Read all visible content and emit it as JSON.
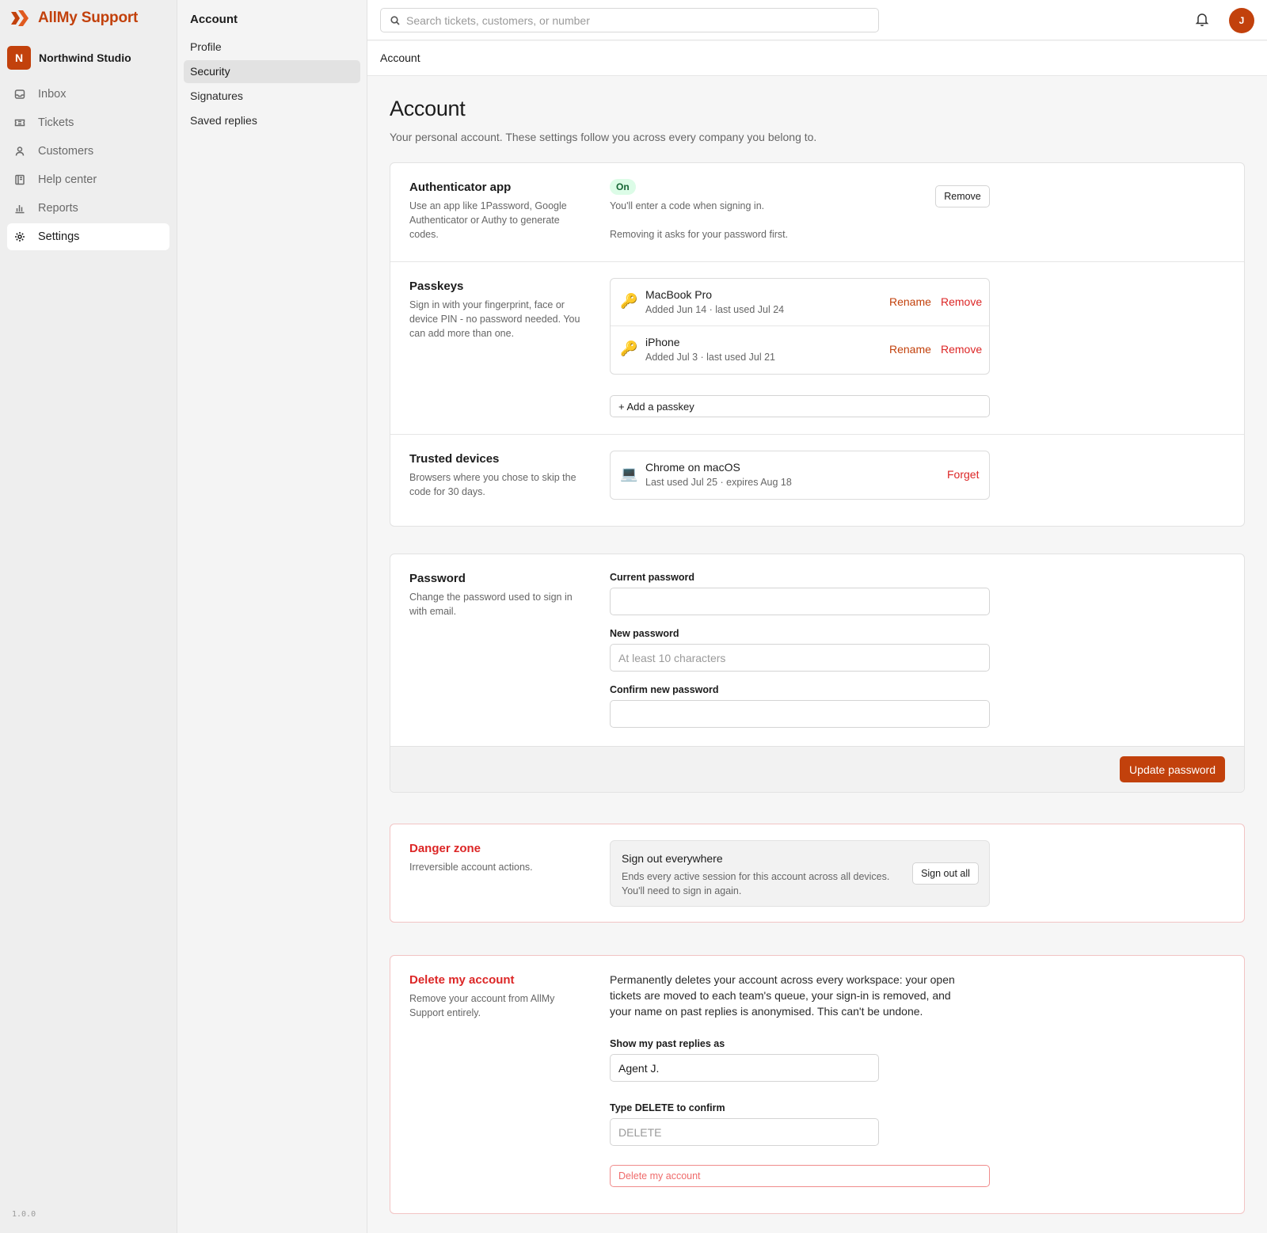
{
  "brand": {
    "name": "AllMy Support",
    "accent": "#c2410c"
  },
  "workspace": {
    "initial": "N",
    "name": "Northwind Studio"
  },
  "nav": {
    "items": [
      {
        "label": "Inbox",
        "icon": "inbox-icon"
      },
      {
        "label": "Tickets",
        "icon": "ticket-icon"
      },
      {
        "label": "Customers",
        "icon": "person-icon"
      },
      {
        "label": "Help center",
        "icon": "book-icon"
      },
      {
        "label": "Reports",
        "icon": "bar-chart-icon"
      },
      {
        "label": "Settings",
        "icon": "gear-icon",
        "active": true
      }
    ]
  },
  "version": "1.0.0",
  "subnav": {
    "title": "Account",
    "items": [
      "Profile",
      "Security",
      "Signatures",
      "Saved replies"
    ],
    "active": "Security"
  },
  "topbar": {
    "search_placeholder": "Search tickets, customers, or number",
    "user_initial": "J"
  },
  "breadcrumb": "Account",
  "page": {
    "title": "Account",
    "subtitle": "Your personal account. These settings follow you across every company you belong to."
  },
  "security": {
    "authenticator": {
      "title": "Authenticator app",
      "desc": "Use an app like 1Password, Google Authenticator or Authy to generate codes.",
      "status": "On",
      "status_color": "#166534",
      "info": "You'll enter a code when signing in.",
      "note": "Removing it asks for your password first.",
      "remove_label": "Remove"
    },
    "passkeys": {
      "title": "Passkeys",
      "desc": "Sign in with your fingerprint, face or device PIN - no password needed. You can add more than one.",
      "items": [
        {
          "name": "MacBook Pro",
          "meta": "Added Jun 14 · last used Jul 24",
          "icon": "key-icon"
        },
        {
          "name": "iPhone",
          "meta": "Added Jul 3 · last used Jul 21",
          "icon": "key-icon"
        }
      ],
      "rename_label": "Rename",
      "remove_label": "Remove",
      "add_label": "+ Add a passkey"
    },
    "trusted": {
      "title": "Trusted devices",
      "desc": "Browsers where you chose to skip the code for 30 days.",
      "device": {
        "name": "Chrome on macOS",
        "meta": "Last used Jul 25 · expires Aug 18",
        "icon": "laptop-icon"
      },
      "forget_label": "Forget"
    }
  },
  "password": {
    "title": "Password",
    "desc": "Change the password used to sign in with email.",
    "current_label": "Current password",
    "current_value": "",
    "new_label": "New password",
    "new_placeholder": "At least 10 characters",
    "confirm_label": "Confirm new password",
    "confirm_value": "",
    "submit_label": "Update password"
  },
  "danger": {
    "title": "Danger zone",
    "desc": "Irreversible account actions.",
    "signout_title": "Sign out everywhere",
    "signout_desc": "Ends every active session for this account across all devices. You'll need to sign in again.",
    "signout_button": "Sign out all"
  },
  "delete": {
    "title": "Delete my account",
    "desc": "Remove your account from AllMy Support entirely.",
    "text": "Permanently deletes your account across every workspace: your open tickets are moved to each team's queue, your sign-in is removed, and your name on past replies is anonymised. This can't be undone.",
    "alias_label": "Show my past replies as",
    "alias_value": "Agent J.",
    "confirm_label": "Type DELETE to confirm",
    "confirm_placeholder": "DELETE",
    "button_label": "Delete my account",
    "danger_color": "#dc2626"
  }
}
